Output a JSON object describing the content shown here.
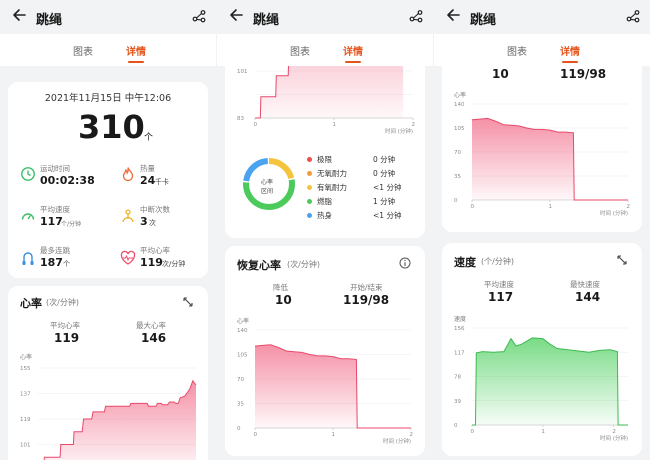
{
  "app": {
    "title": "跳绳",
    "tab_chart": "图表",
    "tab_details": "详情"
  },
  "summary": {
    "datetime": "2021年11月15日 中午12:06",
    "count": "310",
    "count_unit": "个",
    "stats": {
      "duration_label": "运动时间",
      "duration_value": "00:02:38",
      "calories_label": "热量",
      "calories_value": "24",
      "calories_unit": "千卡",
      "avg_speed_label": "平均速度",
      "avg_speed_value": "117",
      "avg_speed_unit": "个/分钟",
      "interruptions_label": "中断次数",
      "interruptions_value": "3",
      "interruptions_unit": "次",
      "max_streak_label": "最多连跳",
      "max_streak_value": "187",
      "max_streak_unit": "个",
      "avg_hr_label": "平均心率",
      "avg_hr_value": "119",
      "avg_hr_unit": "次/分钟"
    }
  },
  "heart_rate": {
    "title": "心率",
    "unit": "(次/分钟)",
    "avg_label": "平均心率",
    "avg_value": "119",
    "max_label": "最大心率",
    "max_value": "146",
    "axis_caption": "心率",
    "ticks": [
      "155",
      "137",
      "119",
      "101",
      "83"
    ],
    "top_ticks": [
      "119",
      "101",
      "83"
    ],
    "x_ticks": [
      "0",
      "1",
      "2"
    ],
    "x_label": "时间 (分钟)"
  },
  "zones": {
    "donut_label_1": "心率",
    "donut_label_2": "区间",
    "items": [
      {
        "label": "极限",
        "value": "0 分钟",
        "color": "#ef4d4d"
      },
      {
        "label": "无氧耐力",
        "value": "0 分钟",
        "color": "#f39a3a"
      },
      {
        "label": "有氧耐力",
        "value": "<1 分钟",
        "color": "#f4c43d"
      },
      {
        "label": "燃脂",
        "value": "1 分钟",
        "color": "#4cca5c"
      },
      {
        "label": "热身",
        "value": "<1 分钟",
        "color": "#4aa3ee"
      }
    ]
  },
  "recovery": {
    "title": "恢复心率",
    "unit": "(次/分钟)",
    "drop_label": "降低",
    "drop_value": "10",
    "start_end_label": "开始/结束",
    "start_end_value": "119/98",
    "axis_caption": "心率",
    "ticks": [
      "140",
      "105",
      "70",
      "35",
      "0"
    ],
    "x_ticks": [
      "0",
      "1",
      "2"
    ],
    "x_label": "时间 (分钟)"
  },
  "speed": {
    "title": "速度",
    "unit": "(个/分钟)",
    "avg_label": "平均速度",
    "avg_value": "117",
    "max_label": "最快速度",
    "max_value": "144",
    "axis_caption": "速度",
    "ticks": [
      "156",
      "117",
      "78",
      "39",
      "0"
    ],
    "x_ticks": [
      "0",
      "1",
      "2"
    ],
    "x_label": "时间 (分钟)"
  },
  "chart_data": [
    {
      "type": "area",
      "title": "心率",
      "ylabel": "心率",
      "xlabel": "时间 (分钟)",
      "ylim": [
        83,
        155
      ],
      "xlim": [
        0,
        2.5
      ],
      "x": [
        0,
        0.09,
        0.1,
        0.35,
        0.36,
        0.56,
        0.57,
        0.7,
        0.72,
        0.85,
        0.87,
        1.05,
        1.07,
        1.45,
        1.47,
        1.73,
        1.75,
        1.87,
        1.89,
        1.95,
        1.97,
        2.05,
        2.08,
        2.15,
        2.18,
        2.22,
        2.25,
        2.32,
        2.4,
        2.45,
        2.5
      ],
      "values": [
        83,
        83,
        92,
        92,
        101,
        101,
        110,
        110,
        119,
        119,
        124,
        124,
        128,
        128,
        130,
        130,
        128,
        128,
        130,
        130,
        129,
        129,
        131,
        131,
        130,
        130,
        134,
        135,
        140,
        146,
        143
      ]
    },
    {
      "type": "area",
      "title": "恢复心率",
      "ylabel": "心率",
      "xlabel": "时间 (分钟)",
      "ylim": [
        0,
        140
      ],
      "xlim": [
        0,
        2
      ],
      "x": [
        0,
        0.1,
        0.2,
        0.3,
        0.4,
        0.5,
        0.6,
        0.7,
        0.8,
        0.9,
        1.0,
        1.1,
        1.2,
        1.3,
        1.31,
        2.0
      ],
      "values": [
        117,
        118,
        119,
        115,
        110,
        109,
        108,
        105,
        103,
        103,
        102,
        99,
        99,
        98,
        0,
        0
      ]
    },
    {
      "type": "area",
      "title": "速度",
      "ylabel": "速度",
      "xlabel": "时间 (分钟)",
      "ylim": [
        0,
        156
      ],
      "xlim": [
        0,
        2.2
      ],
      "x": [
        0,
        0.05,
        0.06,
        0.15,
        0.3,
        0.45,
        0.55,
        0.62,
        0.7,
        0.85,
        1.0,
        1.1,
        1.2,
        1.35,
        1.5,
        1.65,
        1.8,
        1.95,
        2.05,
        2.06,
        2.2
      ],
      "values": [
        0,
        0,
        116,
        118,
        117,
        118,
        139,
        127,
        130,
        140,
        139,
        130,
        123,
        121,
        119,
        117,
        120,
        121,
        118,
        0,
        0
      ]
    }
  ]
}
